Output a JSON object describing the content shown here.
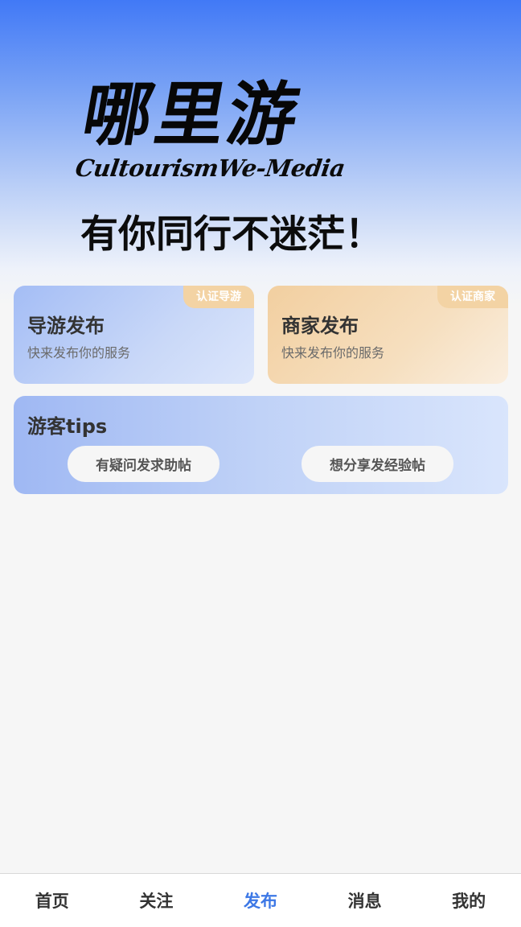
{
  "brand": {
    "title": "哪里游",
    "subtitle": "CultourismWe-Media",
    "slogan": "有你同行不迷茫！"
  },
  "cards": [
    {
      "badge": "认证导游",
      "title": "导游发布",
      "desc": "快来发布你的服务"
    },
    {
      "badge": "认证商家",
      "title": "商家发布",
      "desc": "快来发布你的服务"
    }
  ],
  "tips": {
    "title": "游客tips",
    "buttons": [
      "有疑问发求助帖",
      "想分享发经验帖"
    ]
  },
  "tabbar": {
    "items": [
      "首页",
      "关注",
      "发布",
      "消息",
      "我的"
    ],
    "active_index": 2
  },
  "colors": {
    "accent": "#3d78e6",
    "hero_top": "#4179f6",
    "badge": "#f3d3a4"
  }
}
